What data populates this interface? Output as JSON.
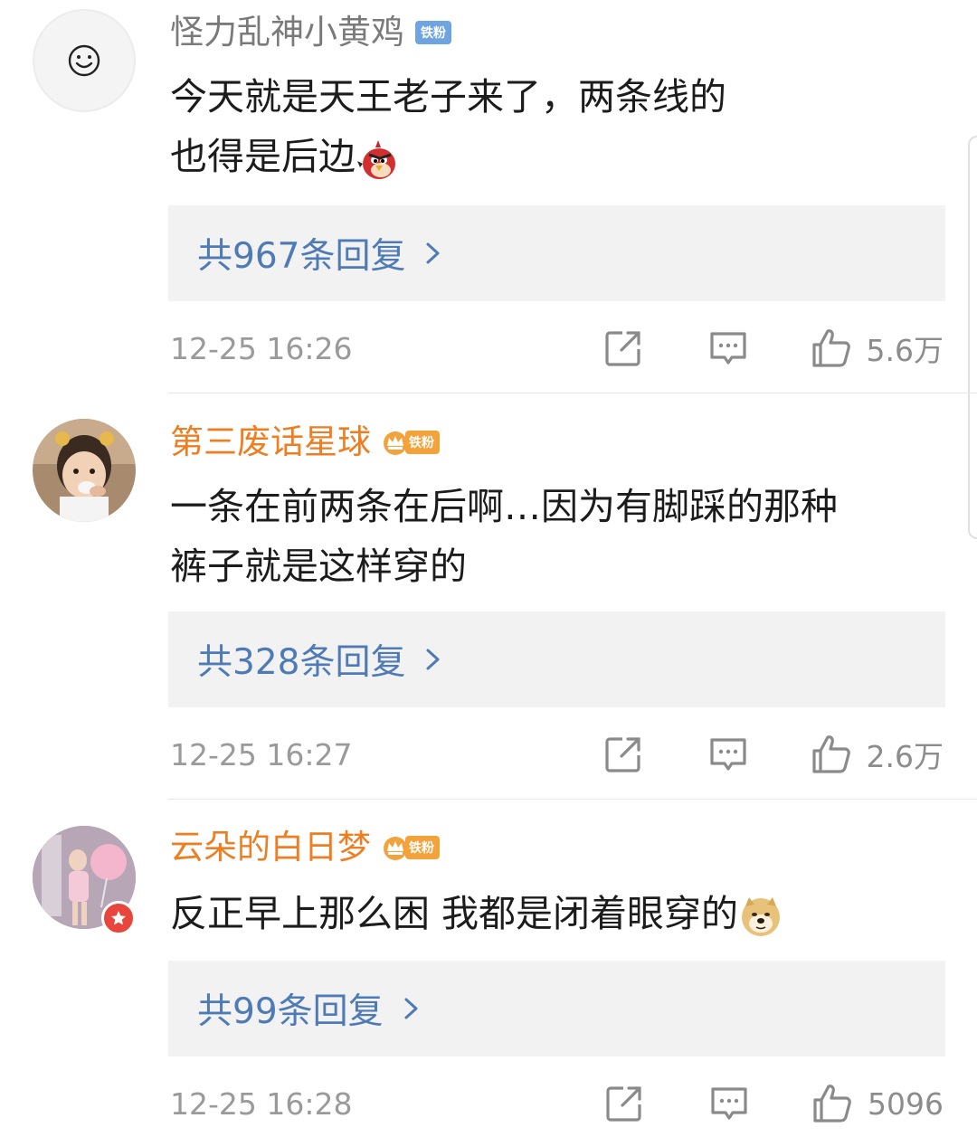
{
  "comments": [
    {
      "username": "怪力乱神小黄鸡",
      "badge": "铁粉",
      "text_line1": "今天就是天王老子来了，两条线的",
      "text_line2": "也得是后边",
      "emoji_name": "angry-bird-emoji",
      "replies_label": "共967条回复",
      "time": "12-25 16:26",
      "likes": "5.6万"
    },
    {
      "username": "第三废话星球",
      "badge": "铁粉",
      "text_line1": "一条在前两条在后啊…因为有脚踩的那种",
      "text_line2": "裤子就是这样穿的",
      "replies_label": "共328条回复",
      "time": "12-25 16:27",
      "likes": "2.6万"
    },
    {
      "username": "云朵的白日梦",
      "badge": "铁粉",
      "text_line1": "反正早上那么困 我都是闭着眼穿的",
      "emoji_name": "doge-emoji",
      "replies_label": "共99条回复",
      "time": "12-25 16:28",
      "likes": "5096"
    }
  ],
  "colors": {
    "link_blue": "#4e7bb6",
    "username_orange": "#ed7e22",
    "username_gray": "#7a7a7a",
    "reply_bg": "#f2f2f2",
    "badge_blue": "#6fa4e3",
    "badge_gold": "#f2a33c"
  }
}
